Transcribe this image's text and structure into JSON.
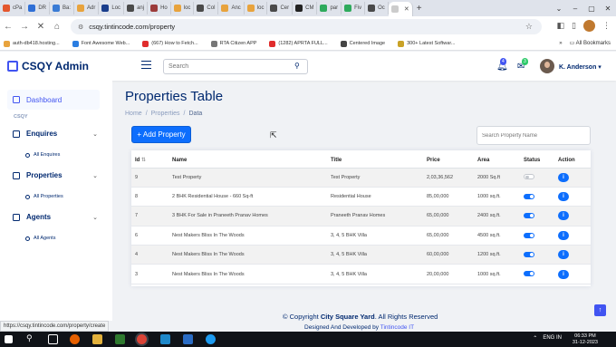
{
  "browser": {
    "tabs": [
      {
        "label": "cPa",
        "color": "#e4572e"
      },
      {
        "label": "DR",
        "color": "#2f6fd6"
      },
      {
        "label": "Ba:",
        "color": "#3a7bd5"
      },
      {
        "label": "Adr",
        "color": "#e8a33d"
      },
      {
        "label": "Loc",
        "color": "#1a3e8c"
      },
      {
        "label": "anj",
        "color": "#4a4a4a"
      },
      {
        "label": "Ho",
        "color": "#9c3b3b"
      },
      {
        "label": "loc",
        "color": "#e8a33d"
      },
      {
        "label": "Col",
        "color": "#4a4a4a"
      },
      {
        "label": "Anc",
        "color": "#e8a33d"
      },
      {
        "label": "loc",
        "color": "#e8a33d"
      },
      {
        "label": "Cer",
        "color": "#4a4a4a"
      },
      {
        "label": "CM",
        "color": "#222"
      },
      {
        "label": "par",
        "color": "#2eaa5c"
      },
      {
        "label": "Fiv",
        "color": "#2eaa5c"
      },
      {
        "label": "Oc",
        "color": "#4a4a4a"
      }
    ],
    "url": "csqy.tintincode.com/property",
    "bookmarks": [
      {
        "label": "auth-db418.hosting...",
        "color": "#e8a33d"
      },
      {
        "label": "Font Awesome Web...",
        "color": "#2a7de1"
      },
      {
        "label": "(667) How to Fetch...",
        "color": "#e02c2c"
      },
      {
        "label": "RTA Citizen APP",
        "color": "#777"
      },
      {
        "label": "(1282) APRTA FULL...",
        "color": "#e02c2c"
      },
      {
        "label": "Centered Image",
        "color": "#444"
      },
      {
        "label": "300+ Latest Softwar...",
        "color": "#c9a227"
      }
    ],
    "all_bookmarks": "All Bookmarks",
    "status_url": "https://csqy.tintincode.com/property/create"
  },
  "header": {
    "app_name": "CSQY Admin",
    "search_placeholder": "Search",
    "notif_count": "4",
    "msg_count": "3",
    "user_name": "K. Anderson"
  },
  "sidebar": {
    "dashboard": "Dashboard",
    "heading": "CSQY",
    "groups": [
      {
        "label": "Enquires",
        "sub": "All Enquires"
      },
      {
        "label": "Properties",
        "sub": "All Properties"
      },
      {
        "label": "Agents",
        "sub": "All Agents"
      }
    ]
  },
  "main": {
    "page_title": "Properties Table",
    "breadcrumb": [
      "Home",
      "/",
      "Properties",
      "/",
      "Data"
    ],
    "add_button": "+ Add Property",
    "search_placeholder": "Search Property Name",
    "columns": [
      "Id",
      "Name",
      "Title",
      "Price",
      "Area",
      "Status",
      "Action"
    ],
    "rows": [
      {
        "id": "9",
        "name": "Test Property",
        "title": "Test Property",
        "price": "2,03,36,562",
        "area": "2000 Sq.ft",
        "status": false
      },
      {
        "id": "8",
        "name": "2 BHK Residential House - 660 Sq-ft",
        "title": "Residential House",
        "price": "85,00,000",
        "area": "1000 sq.ft.",
        "status": true
      },
      {
        "id": "7",
        "name": "3 BHK For Sale in Praneeth Pranav Homes",
        "title": "Praneeth Pranav Homes",
        "price": "65,00,000",
        "area": "2400 sq.ft.",
        "status": true
      },
      {
        "id": "6",
        "name": "Nest Makers Bliss In The Woods",
        "title": "3, 4, 5 BHK Villa",
        "price": "65,00,000",
        "area": "4500 sq.ft.",
        "status": true
      },
      {
        "id": "4",
        "name": "Nest Makers Bliss In The Woods",
        "title": "3, 4, 5 BHK Villa",
        "price": "60,00,000",
        "area": "1200 sq.ft.",
        "status": true
      },
      {
        "id": "3",
        "name": "Nest Makers Bliss In The Woods",
        "title": "3, 4, 5 BHK Villa",
        "price": "20,00,000",
        "area": "1000 sq.ft.",
        "status": true
      }
    ],
    "action_label": "i"
  },
  "footer": {
    "copyright_prefix": "© Copyright",
    "company": "City Square Yard",
    "rights": ". All Rights Reserved",
    "designed_prefix": "Designed And Developed by",
    "developer": "Tintincode IT"
  },
  "taskbar": {
    "time": "06:33 PM",
    "date": "31-12-2023",
    "lang": "ENG IN"
  }
}
